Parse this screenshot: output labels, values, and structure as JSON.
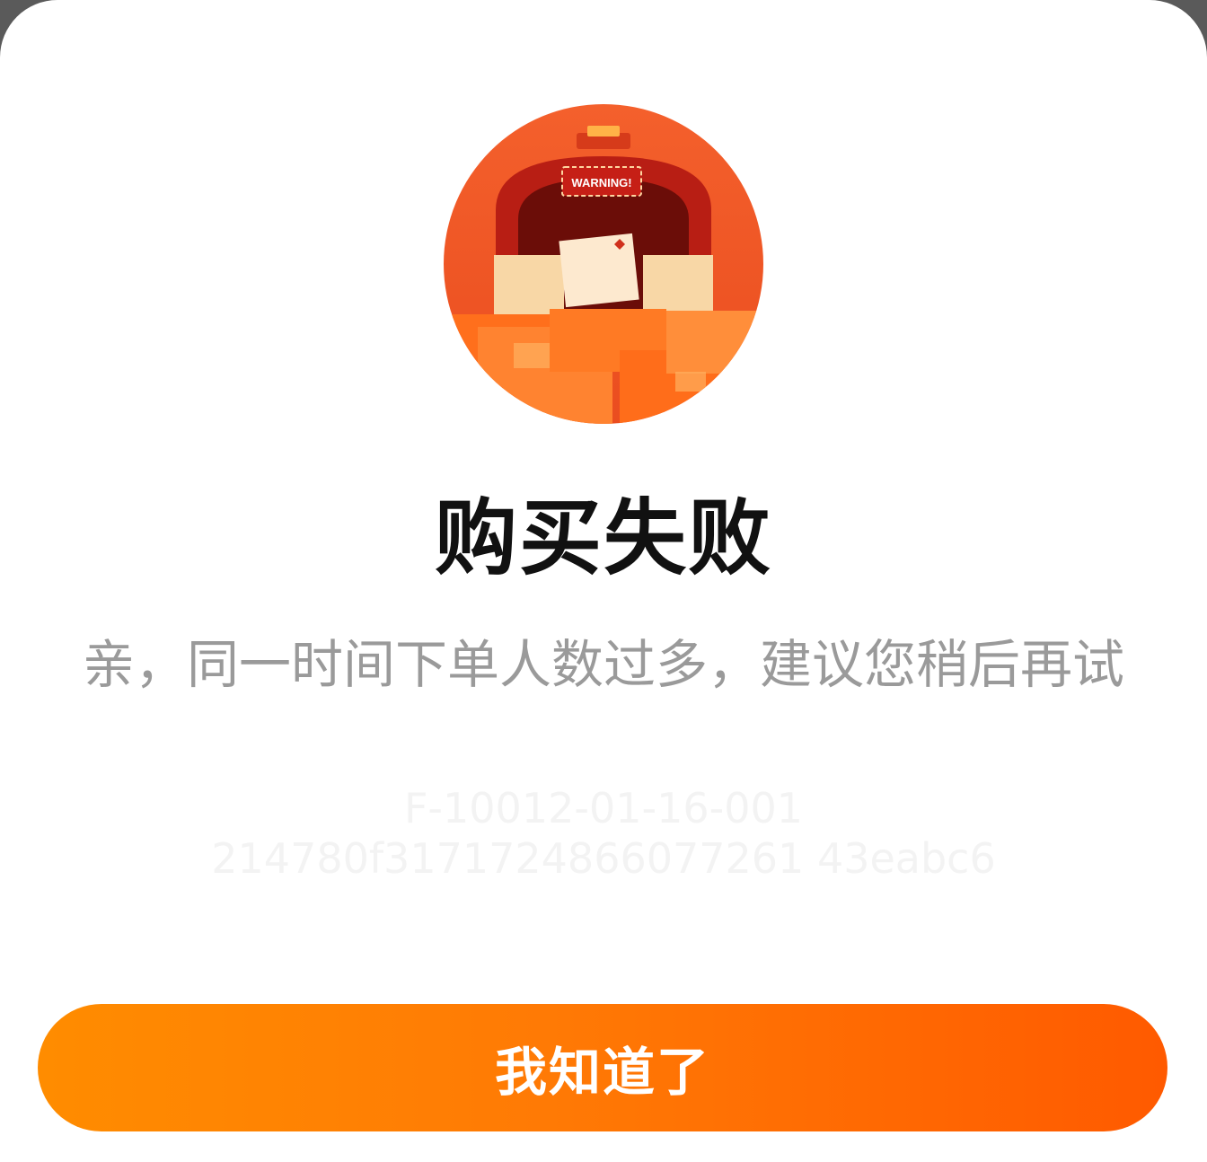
{
  "dialog": {
    "illustration": {
      "icon": "warning-parcels-illustration-icon",
      "sign_text": "WARNING!",
      "colors": {
        "circle": "#f0602a",
        "box": "#ff7a1a",
        "paper": "#fbe6c8"
      }
    },
    "title": "购买失败",
    "message": "亲，同一时间下单人数过多，建议您稍后再试",
    "error_code": "F-10012-01-16-001",
    "trace_id": "214780f3171724866077261 43eabc6",
    "confirm_label": "我知道了",
    "colors": {
      "accent_start": "#ff8c00",
      "accent_end": "#ff5a00"
    }
  }
}
